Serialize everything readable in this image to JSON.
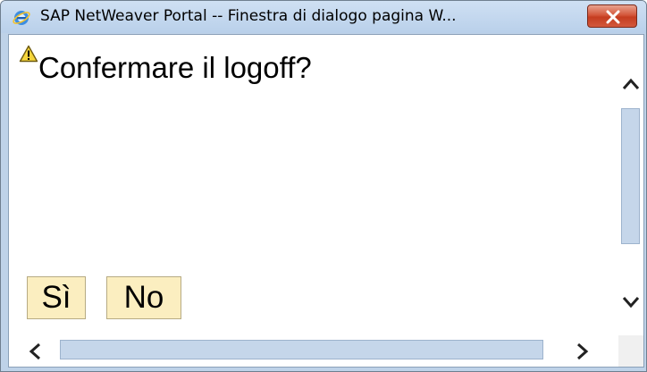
{
  "window": {
    "title": "SAP NetWeaver Portal -- Finestra di dialogo pagina W...",
    "icon": "internet-explorer-icon",
    "close_icon": "close-icon"
  },
  "dialog": {
    "warning_icon": "warning-icon",
    "message": "Confermare il logoff?",
    "buttons": {
      "yes_label": "Sì",
      "no_label": "No"
    }
  },
  "scrollbars": {
    "vertical": {
      "up_icon": "chevron-up-icon",
      "down_icon": "chevron-down-icon"
    },
    "horizontal": {
      "left_icon": "chevron-left-icon",
      "right_icon": "chevron-right-icon"
    }
  },
  "colors": {
    "button_face": "#fbeec0",
    "close_button": "#c53d20",
    "frame": "#bed2e8",
    "scroll_thumb": "#c5d6ea"
  }
}
